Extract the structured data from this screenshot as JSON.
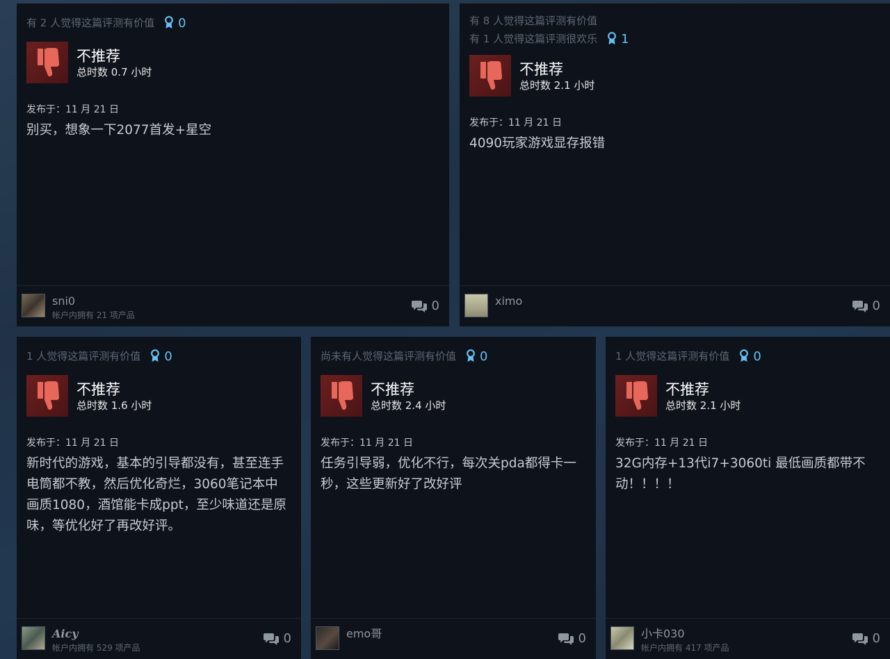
{
  "colors": {
    "card_background": "#0e121a",
    "thumb_down_background": "#6b1f1f",
    "thumb_down_icon": "#e7685a",
    "award_accent": "#66c0f4"
  },
  "reviews": [
    {
      "helpful": [
        "有 2 人觉得这篇评测有价值"
      ],
      "awards": "0",
      "verdict": "不推荐",
      "playtime": "总时数 0.7 小时",
      "posted": "发布于：11 月 21 日",
      "text": "别买，想象一下2077首发+星空",
      "author": "sni0",
      "products_owned": "帐户内拥有 21 项产品",
      "comments": "0"
    },
    {
      "helpful": [
        "有 8 人觉得这篇评测有价值",
        "有 1 人觉得这篇评测很欢乐"
      ],
      "awards": "1",
      "verdict": "不推荐",
      "playtime": "总时数 2.1 小时",
      "posted": "发布于：11 月 21 日",
      "text": "4090玩家游戏显存报错",
      "author": "ximo",
      "products_owned": "",
      "comments": "0"
    },
    {
      "helpful": [
        "1 人觉得这篇评测有价值"
      ],
      "awards": "0",
      "verdict": "不推荐",
      "playtime": "总时数 1.6 小时",
      "posted": "发布于：11 月 21 日",
      "text": "新时代的游戏，基本的引导都没有，甚至连手\n电筒都不教，然后优化奇烂，3060笔记本中\n画质1080，酒馆能卡成ppt，至少味道还是原\n味，等优化好了再改好评。",
      "author": "Aicy",
      "products_owned": "帐户内拥有 529 项产品",
      "comments": "0"
    },
    {
      "helpful": [
        "尚未有人觉得这篇评测有价值"
      ],
      "awards": "0",
      "verdict": "不推荐",
      "playtime": "总时数 2.4 小时",
      "posted": "发布于：11 月 21 日",
      "text": "任务引导弱，优化不行，每次关pda都得卡一\n秒，这些更新好了改好评",
      "author": "emo哥",
      "products_owned": "",
      "comments": "0"
    },
    {
      "helpful": [
        "1 人觉得这篇评测有价值"
      ],
      "awards": "0",
      "verdict": "不推荐",
      "playtime": "总时数 2.1 小时",
      "posted": "发布于：11 月 21 日",
      "text": "32G内存+13代i7+3060ti 最低画质都带不\n动！！！！",
      "author": "小卡030",
      "products_owned": "帐户内拥有 417 项产品",
      "comments": "0"
    }
  ]
}
